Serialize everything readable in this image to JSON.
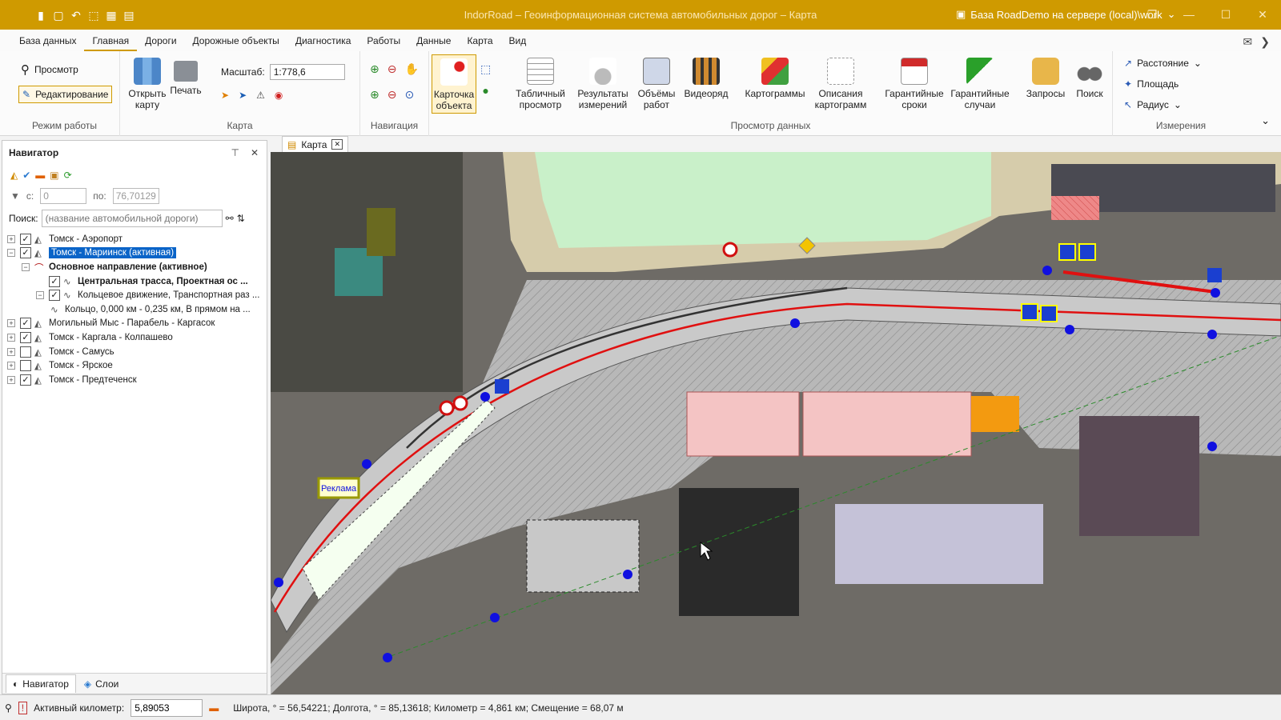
{
  "window": {
    "title": "IndorRoad – Геоинформационная система автомобильных дорог – Карта",
    "database": "База RoadDemo на сервере (local)\\work"
  },
  "menu_tabs": [
    "База данных",
    "Главная",
    "Дороги",
    "Дорожные объекты",
    "Диагностика",
    "Работы",
    "Данные",
    "Карта",
    "Вид"
  ],
  "ribbon": {
    "mode": {
      "view": "Просмотр",
      "edit": "Редактирование",
      "label": "Режим работы"
    },
    "map": {
      "open": "Открыть карту",
      "print": "Печать",
      "scale_label": "Масштаб:",
      "scale_value": "1:778,6",
      "label": "Карта"
    },
    "navigation": {
      "label": "Навигация"
    },
    "data_view": {
      "card": "Карточка объекта",
      "table": "Табличный просмотр",
      "measurements": "Результаты измерений",
      "volumes": "Объёмы работ",
      "video": "Видеоряд",
      "cartograms": "Картограммы",
      "cartogram_desc": "Описания картограмм",
      "warranty_terms": "Гарантийные сроки",
      "warranty_cases": "Гарантийные случаи",
      "queries": "Запросы",
      "search": "Поиск",
      "label": "Просмотр данных"
    },
    "measure": {
      "distance": "Расстояние",
      "area": "Площадь",
      "radius": "Радиус",
      "label": "Измерения"
    }
  },
  "navigator": {
    "title": "Навигатор",
    "filter_from_label": "с:",
    "filter_from": "0",
    "filter_to_label": "по:",
    "filter_to": "76,70129",
    "search_label": "Поиск:",
    "search_placeholder": "(название автомобильной дороги)",
    "tree": [
      {
        "label": "Томск - Аэропорт",
        "level": 0,
        "checked": true
      },
      {
        "label": "Томск - Мариинск (активная)",
        "level": 0,
        "checked": true,
        "selected": true
      },
      {
        "label": "Основное направление (активное)",
        "level": 1,
        "bold": true
      },
      {
        "label": "Центральная трасса, Проектная ос ...",
        "level": 2,
        "checked": true,
        "bold": true
      },
      {
        "label": "Кольцевое движение, Транспортная раз ...",
        "level": 2,
        "checked": true
      },
      {
        "label": "Кольцо, 0,000 км - 0,235 км, В прямом на ...",
        "level": 3
      },
      {
        "label": "Могильный Мыс - Парабель - Каргасок",
        "level": 0,
        "checked": true
      },
      {
        "label": "Томск - Каргала - Колпашево",
        "level": 0,
        "checked": true
      },
      {
        "label": "Томск - Самусь",
        "level": 0,
        "checked": false
      },
      {
        "label": "Томск - Ярское",
        "level": 0,
        "checked": false
      },
      {
        "label": "Томск - Предтеченск",
        "level": 0,
        "checked": true
      }
    ],
    "tabs": [
      "Навигатор",
      "Слои"
    ]
  },
  "map": {
    "tab_label": "Карта",
    "billboard": "Реклама"
  },
  "status": {
    "active_km_label": "Активный километр:",
    "active_km": "5,89053",
    "coords": "Широта, ° = 56,54221; Долгота, ° = 85,13618; Километр = 4,861 км; Смещение = 68,07 м"
  },
  "colors": {
    "accent": "#cf9a00",
    "selection": "#0a64c8",
    "road_axis": "#e01010",
    "marker": "#1010e0"
  }
}
